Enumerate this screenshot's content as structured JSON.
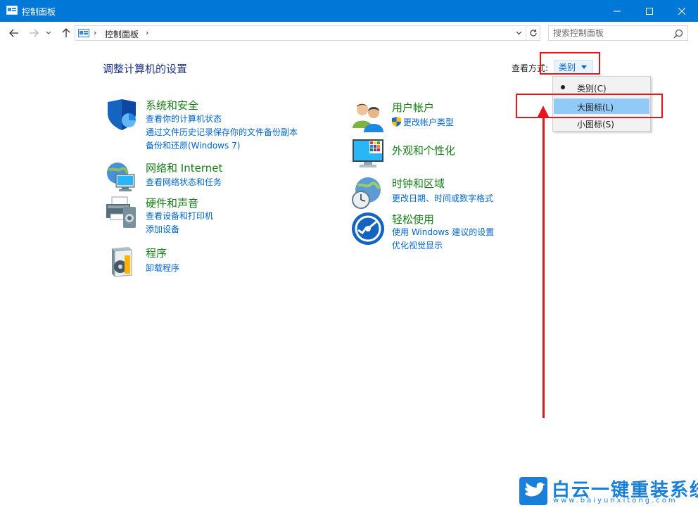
{
  "window": {
    "title": "控制面板"
  },
  "address_bar": {
    "crumb": "控制面板",
    "search_placeholder": "搜索控制面板"
  },
  "main": {
    "title": "调整计算机的设置",
    "view_by_label": "查看方式:",
    "view_by_value": "类别"
  },
  "view_menu": {
    "items": [
      {
        "label": "类别(C)",
        "selected": true
      },
      {
        "label": "大图标(L)",
        "highlighted": true
      },
      {
        "label": "小图标(S)"
      }
    ]
  },
  "categories_left": [
    {
      "heading": "系统和安全",
      "links": [
        "查看你的计算机状态",
        "通过文件历史记录保存你的文件备份副本",
        "备份和还原(Windows 7)"
      ]
    },
    {
      "heading": "网络和 Internet",
      "links": [
        "查看网络状态和任务"
      ]
    },
    {
      "heading": "硬件和声音",
      "links": [
        "查看设备和打印机",
        "添加设备"
      ]
    },
    {
      "heading": "程序",
      "links": [
        "卸载程序"
      ]
    }
  ],
  "categories_right": [
    {
      "heading": "用户帐户",
      "links": [
        "更改帐户类型"
      ]
    },
    {
      "heading": "外观和个性化",
      "links": []
    },
    {
      "heading": "时钟和区域",
      "links": [
        "更改日期、时间或数字格式"
      ]
    },
    {
      "heading": "轻松使用",
      "links": [
        "使用 Windows 建议的设置",
        "优化视觉显示"
      ]
    }
  ],
  "watermark": {
    "brand": "白云一键重装系统",
    "url": "www.baiyunxitong.com"
  },
  "colors": {
    "titlebar": "#0078d7",
    "heading_green": "#177d17",
    "link_blue": "#0066cc",
    "annotation_red": "#e8151b"
  }
}
